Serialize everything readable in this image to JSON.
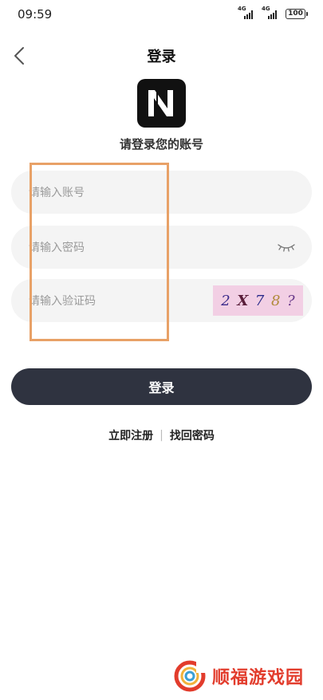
{
  "status_bar": {
    "time": "09:59",
    "network_1": "4G",
    "network_2": "4G",
    "battery": "100"
  },
  "header": {
    "title": "登录"
  },
  "logo": {
    "letter": "N"
  },
  "subtitle": "请登录您的账号",
  "form": {
    "account_placeholder": "请输入账号",
    "password_placeholder": "请输入密码",
    "captcha_placeholder": "请输入验证码",
    "captcha_chars": [
      "2",
      "X",
      "7",
      "8",
      "?"
    ]
  },
  "login_button": "登录",
  "links": {
    "register": "立即注册",
    "separator": "|",
    "forgot": "找回密码"
  },
  "watermark": {
    "text": "顺福游戏园"
  },
  "colors": {
    "accent": "#2f3340",
    "annotation": "#e8a167",
    "watermark": "#e23c2c",
    "captcha_bg": "#f2cfe4"
  }
}
